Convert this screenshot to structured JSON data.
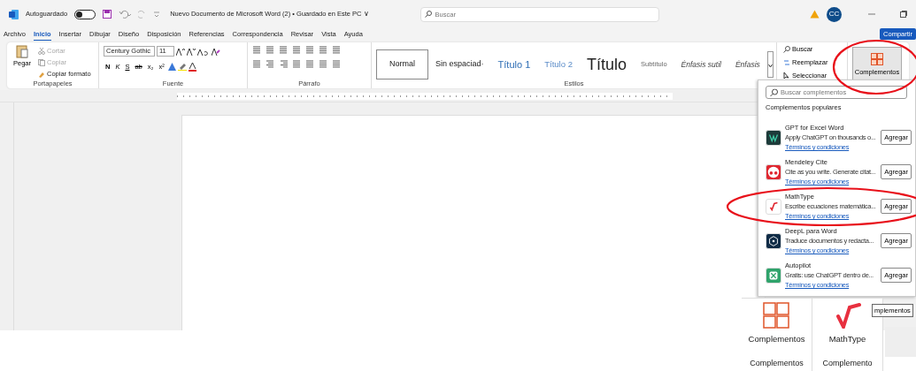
{
  "title_bar": {
    "autosave_label": "Autoguardado",
    "autosave_on": false,
    "document_title": "Nuevo Documento de Microsoft Word (2) • Guardado en Este PC ∨",
    "search": {
      "placeholder": "Buscar"
    },
    "avatar": "CC"
  },
  "tabs": [
    {
      "label": "Archivo",
      "selected": false
    },
    {
      "label": "Inicio",
      "selected": true
    },
    {
      "label": "Insertar",
      "selected": false
    },
    {
      "label": "Dibujar",
      "selected": false
    },
    {
      "label": "Diseño",
      "selected": false
    },
    {
      "label": "Disposición",
      "selected": false
    },
    {
      "label": "Referencias",
      "selected": false
    },
    {
      "label": "Correspondencia",
      "selected": false
    },
    {
      "label": "Revisar",
      "selected": false
    },
    {
      "label": "Vista",
      "selected": false
    },
    {
      "label": "Ayuda",
      "selected": false
    }
  ],
  "share_button": "Compartir",
  "ribbon": {
    "clipboard": {
      "paste": "Pegar",
      "cut": "Cortar",
      "copy": "Copiar",
      "format_painter": "Copiar formato",
      "label": "Portapapeles"
    },
    "font": {
      "name": "Century Gothic",
      "size": "11",
      "buttons": [
        "N",
        "K",
        "S",
        "ab",
        "x₂",
        "x²"
      ],
      "label": "Fuente"
    },
    "paragraph": {
      "label": "Párrafo"
    },
    "styles": {
      "items": [
        {
          "label": "Normal",
          "kind": "normal",
          "selected": true
        },
        {
          "label": "Sin espaciad·",
          "kind": "normal",
          "selected": false
        },
        {
          "label": "Título 1",
          "kind": "heading1",
          "selected": false
        },
        {
          "label": "Título 2",
          "kind": "heading2",
          "selected": false
        },
        {
          "label": "Título",
          "kind": "title",
          "selected": false
        },
        {
          "label": "Subtítulo",
          "kind": "subtitle",
          "selected": false
        },
        {
          "label": "Énfasis sutil",
          "kind": "emphasis",
          "selected": false
        },
        {
          "label": "Énfasis",
          "kind": "emphasis",
          "selected": false
        }
      ],
      "label": "Estilos"
    },
    "editing": [
      "Buscar",
      "Reemplazar",
      "Seleccionar"
    ],
    "addins_button": "Complementos"
  },
  "addins_panel": {
    "search": {
      "placeholder": "Buscar complementos"
    },
    "heading": "Complementos populares",
    "items": [
      {
        "name": "GPT for Excel Word",
        "description": "Apply ChatGPT on thousands o...",
        "terms": "Términos y condiciones",
        "button": "Agregar",
        "color": "#1d3b3a"
      },
      {
        "name": "Mendeley Cite",
        "description": "Cite as you write. Generate citat...",
        "terms": "Términos y condiciones",
        "button": "Agregar",
        "color": "#e0262f"
      },
      {
        "name": "MathType",
        "description": "Escribe ecuaciones matemática...",
        "terms": "Términos y condiciones",
        "button": "Agregar",
        "color": "#ffffff"
      },
      {
        "name": "DeepL para Word",
        "description": "Traduce documentos y redacta...",
        "terms": "Términos y condiciones",
        "button": "Agregar",
        "color": "#0f2b46"
      },
      {
        "name": "Autopilot",
        "description": "Gratis: use ChatGPT dentro de...",
        "terms": "Términos y condiciones",
        "button": "Agregar",
        "color": "#2fa36b"
      }
    ]
  },
  "inset": {
    "buttons": [
      "Complementos",
      "MathType"
    ],
    "groups": [
      "Complementos",
      "Complemento"
    ],
    "side_button": "mplementos"
  }
}
